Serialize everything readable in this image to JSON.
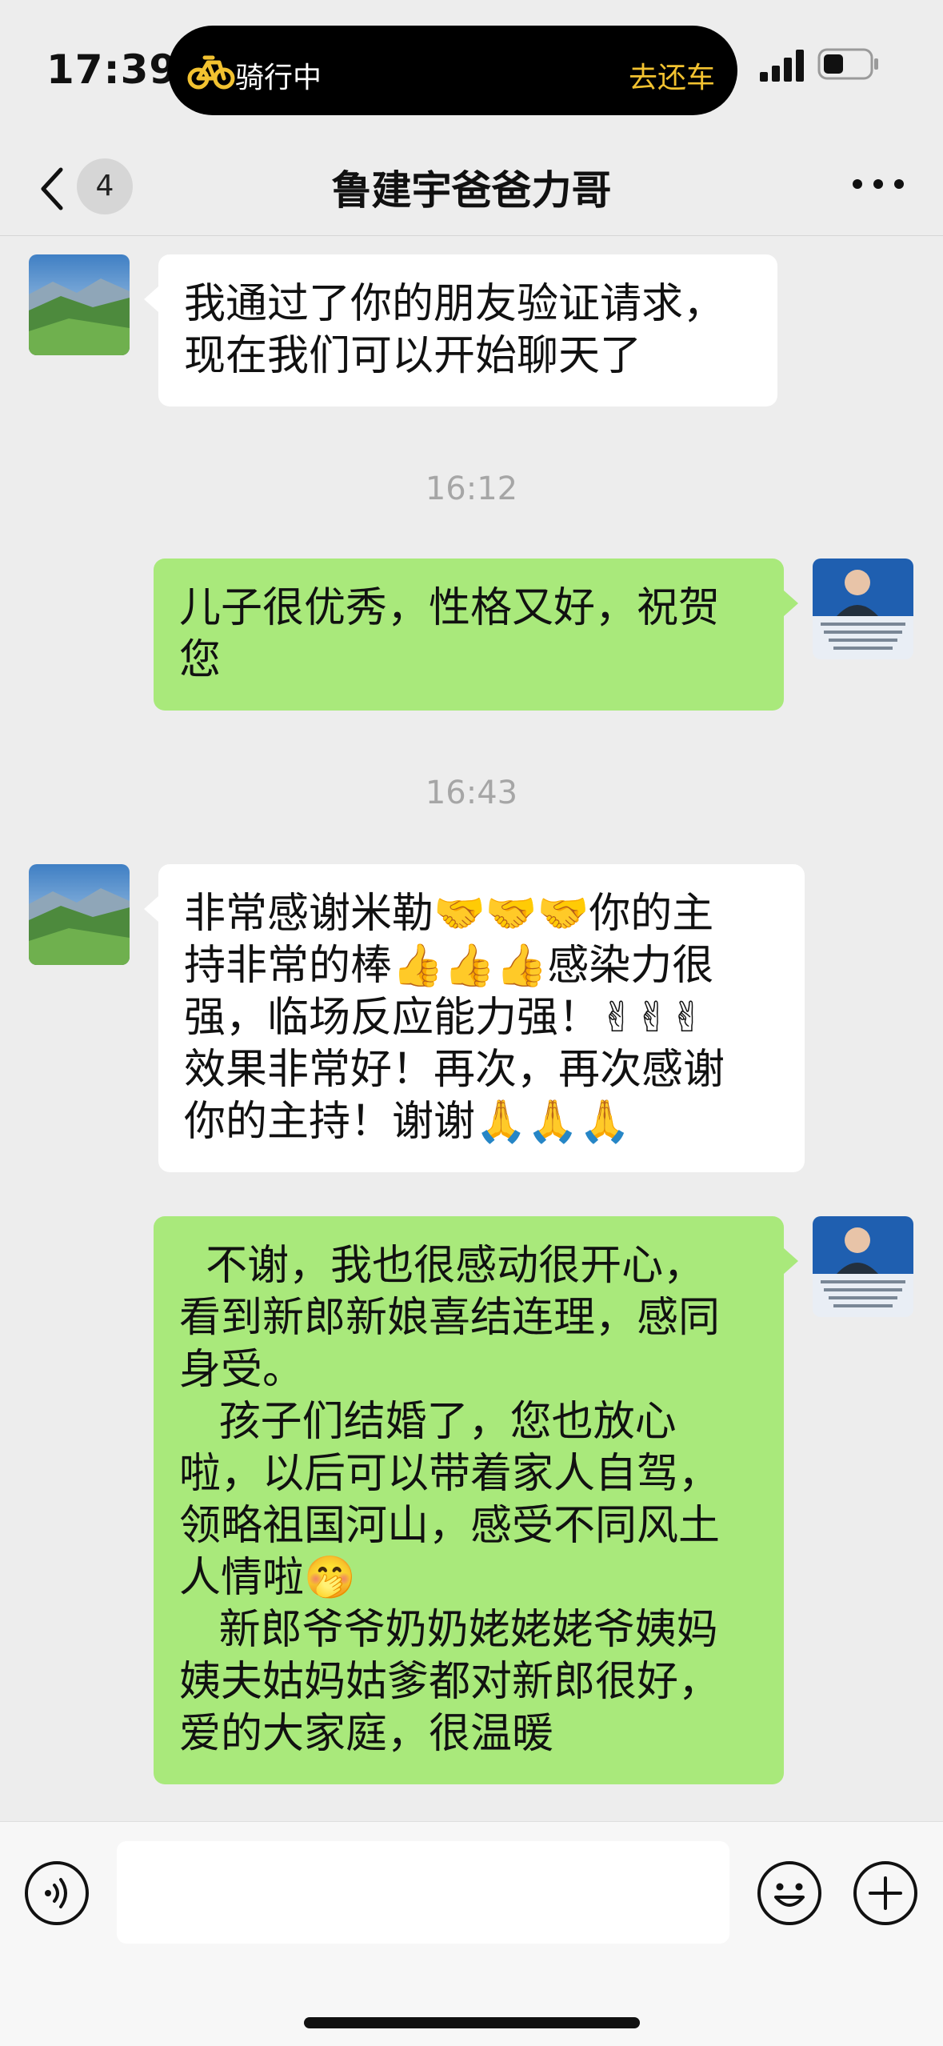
{
  "status_bar": {
    "time": "17:39",
    "activity_label": "骑行中",
    "activity_action": "去还车"
  },
  "nav": {
    "unread_count": "4",
    "title": "鲁建宇爸爸力哥"
  },
  "messages": [
    {
      "id": "m1",
      "side": "in",
      "text": "我通过了你的朋友验证请求，\n现在我们可以开始聊天了"
    },
    {
      "id": "ts1",
      "type": "time",
      "text": "16:12"
    },
    {
      "id": "m2",
      "side": "out",
      "text": "儿子很优秀，性格又好，祝贺\n您"
    },
    {
      "id": "ts2",
      "type": "time",
      "text": "16:43"
    },
    {
      "id": "m3",
      "side": "in",
      "text": "非常感谢米勒🤝🤝🤝你的主\n持非常的棒👍👍👍感染力很\n强，临场反应能力强！✌✌✌\n效果非常好！再次，再次感谢\n你的主持！谢谢🙏🙏🙏"
    },
    {
      "id": "m4",
      "side": "out",
      "text": "  不谢，我也很感动很开心，\n看到新郎新娘喜结连理，感同\n身受。\n   孩子们结婚了，您也放心\n啦，以后可以带着家人自驾，\n领略祖国河山，感受不同风土\n人情啦🤭\n   新郎爷爷奶奶姥姥姥爷姨妈\n姨夫姑妈姑爹都对新郎很好，\n爱的大家庭，很温暖"
    }
  ],
  "input": {
    "value": ""
  },
  "colors": {
    "background": "#ededed",
    "bubble_out": "#a9e97b",
    "bubble_in": "#ffffff",
    "accent_yellow": "#f2c230"
  },
  "icons": {
    "back": "chevron-left-icon",
    "more": "more-dots-icon",
    "voice": "voice-icon",
    "emoji": "emoji-icon",
    "plus": "plus-icon",
    "ride": "bicycle-icon"
  }
}
